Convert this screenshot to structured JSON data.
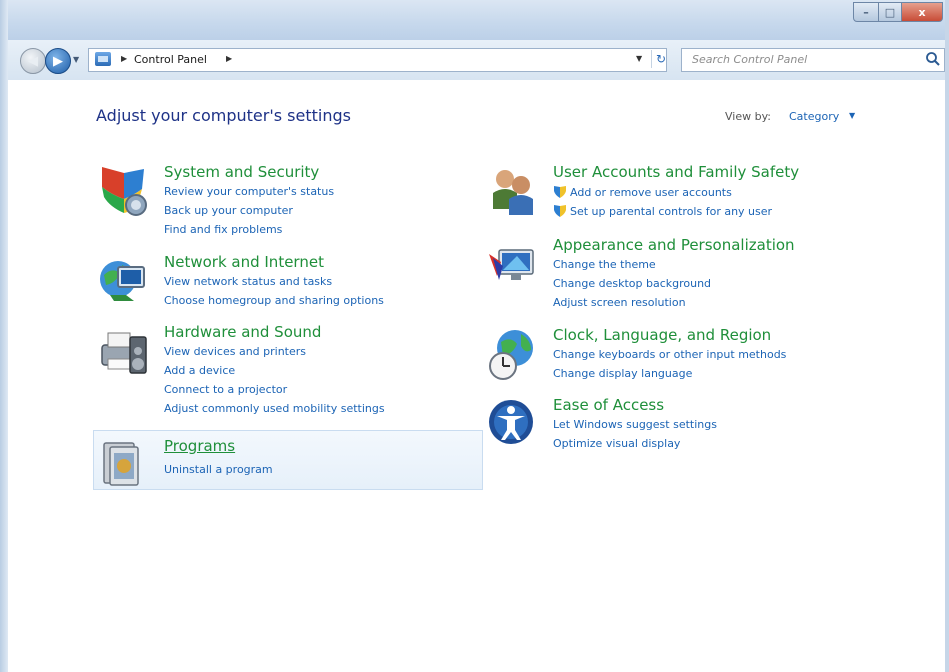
{
  "window": {
    "caption_buttons": {
      "minimize": "–",
      "maximize": "□",
      "close": "x"
    }
  },
  "address_bar": {
    "breadcrumb": "Control Panel",
    "search_placeholder": "Search Control Panel"
  },
  "header": {
    "heading": "Adjust your computer's settings",
    "view_by_label": "View by:",
    "view_by_value": "Category"
  },
  "left_categories": [
    {
      "title": "System and Security",
      "links": [
        "Review your computer's status",
        "Back up your computer",
        "Find and fix problems"
      ]
    },
    {
      "title": "Network and Internet",
      "links": [
        "View network status and tasks",
        "Choose homegroup and sharing options"
      ]
    },
    {
      "title": "Hardware and Sound",
      "links": [
        "View devices and printers",
        "Add a device",
        "Connect to a projector",
        "Adjust commonly used mobility settings"
      ]
    },
    {
      "title": "Programs",
      "links": [
        "Uninstall a program"
      ]
    }
  ],
  "right_categories": [
    {
      "title": "User Accounts and Family Safety",
      "links": [
        "Add or remove user accounts",
        "Set up parental controls for any user"
      ]
    },
    {
      "title": "Appearance and Personalization",
      "links": [
        "Change the theme",
        "Change desktop background",
        "Adjust screen resolution"
      ]
    },
    {
      "title": "Clock, Language, and Region",
      "links": [
        "Change keyboards or other input methods",
        "Change display language"
      ]
    },
    {
      "title": "Ease of Access",
      "links": [
        "Let Windows suggest settings",
        "Optimize visual display"
      ]
    }
  ],
  "colors": {
    "title_green": "#1f8f3a",
    "link_blue": "#1c64b5",
    "heading_navy": "#1e3287"
  }
}
